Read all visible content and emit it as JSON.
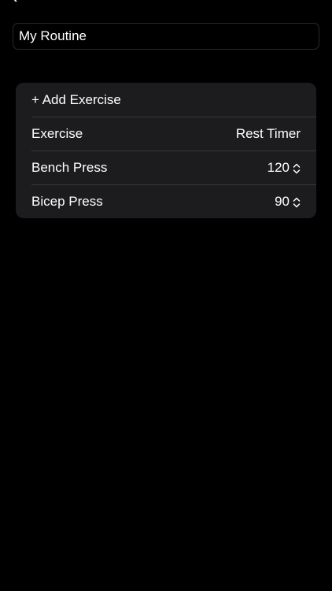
{
  "routine": {
    "name": "My Routine"
  },
  "add_exercise": {
    "label": "+ Add Exercise"
  },
  "table": {
    "headers": {
      "exercise": "Exercise",
      "rest_timer": "Rest Timer"
    },
    "rows": [
      {
        "exercise": "Bench Press",
        "rest": "120"
      },
      {
        "exercise": "Bicep Press",
        "rest": "90"
      }
    ]
  },
  "colors": {
    "background": "#000000",
    "card": "#1c1c1e",
    "separator": "#38383a",
    "text": "#ffffff"
  },
  "icons": {
    "back": "chevron-left-icon",
    "stepper": "chevron-up-down-icon"
  }
}
